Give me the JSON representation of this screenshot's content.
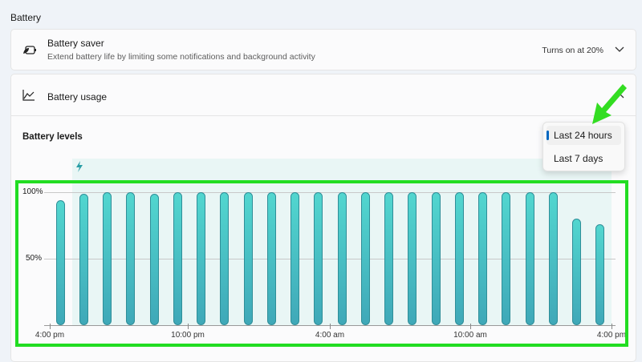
{
  "section_title": "Battery",
  "battery_saver": {
    "title": "Battery saver",
    "subtitle": "Extend battery life by limiting some notifications and background activity",
    "status": "Turns on at 20%"
  },
  "battery_usage": {
    "title": "Battery usage"
  },
  "battery_levels": {
    "title": "Battery levels"
  },
  "period_menu": {
    "options": [
      "Last 24 hours",
      "Last 7 days"
    ],
    "selected": "Last 24 hours"
  },
  "chart_data": {
    "type": "bar",
    "ylabels": [
      "100%",
      "50%"
    ],
    "ylim": [
      0,
      100
    ],
    "xlabels": [
      "4:00 pm",
      "10:00 pm",
      "4:00 am",
      "10:00 am",
      "4:00 pm"
    ],
    "values": [
      94,
      99,
      100,
      100,
      99,
      100,
      100,
      100,
      100,
      100,
      100,
      100,
      100,
      100,
      100,
      100,
      100,
      100,
      100,
      100,
      100,
      100,
      80,
      76
    ],
    "charging": true
  },
  "colors": {
    "accent": "#0067c0",
    "bar": "#4ccfcc",
    "highlight": "#22dd22"
  }
}
